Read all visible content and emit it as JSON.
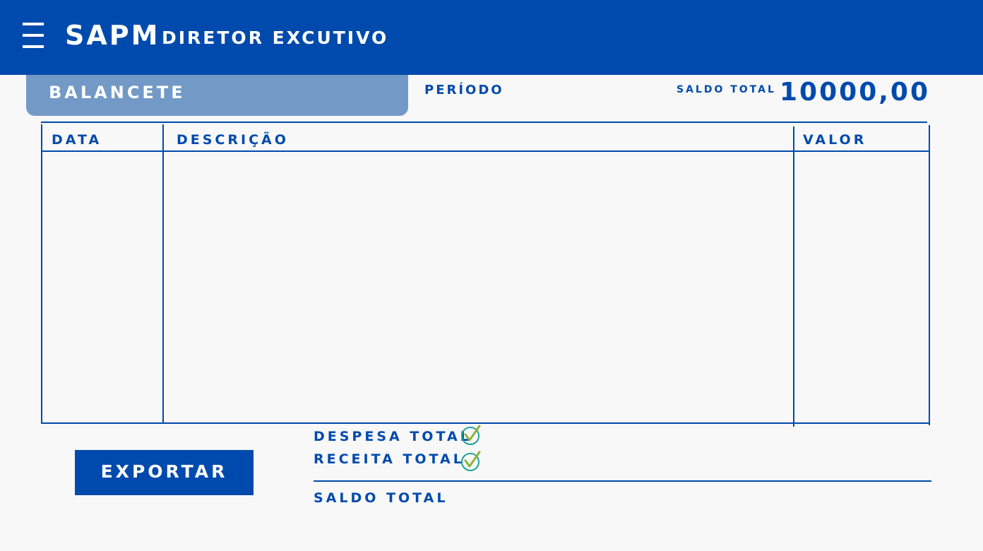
{
  "header": {
    "app_name": "SAPM",
    "role": "DIRETOR EXCUTIVO",
    "menu_icon": "hamburger-menu-icon"
  },
  "tab": {
    "label": "BALANCETE"
  },
  "period": {
    "label": "PERÍODO"
  },
  "balance_summary": {
    "label": "SALDO TOTAL",
    "value": "10000,00"
  },
  "table": {
    "columns": [
      "DATA",
      "DESCRIÇÃO",
      "VALOR"
    ],
    "rows": []
  },
  "footer": {
    "export_label": "EXPORTAR",
    "despesa_label": "DESPESA TOTAL",
    "receita_label": "RECEITA TOTAL",
    "saldo_label": "SALDO TOTAL",
    "check_icon": "checkmark-circle-icon"
  },
  "colors": {
    "primary": "#004aad",
    "tab": "#7399c6",
    "background": "#f8f8f8",
    "check_green": "#8db33a",
    "check_teal": "#1fa39a"
  }
}
